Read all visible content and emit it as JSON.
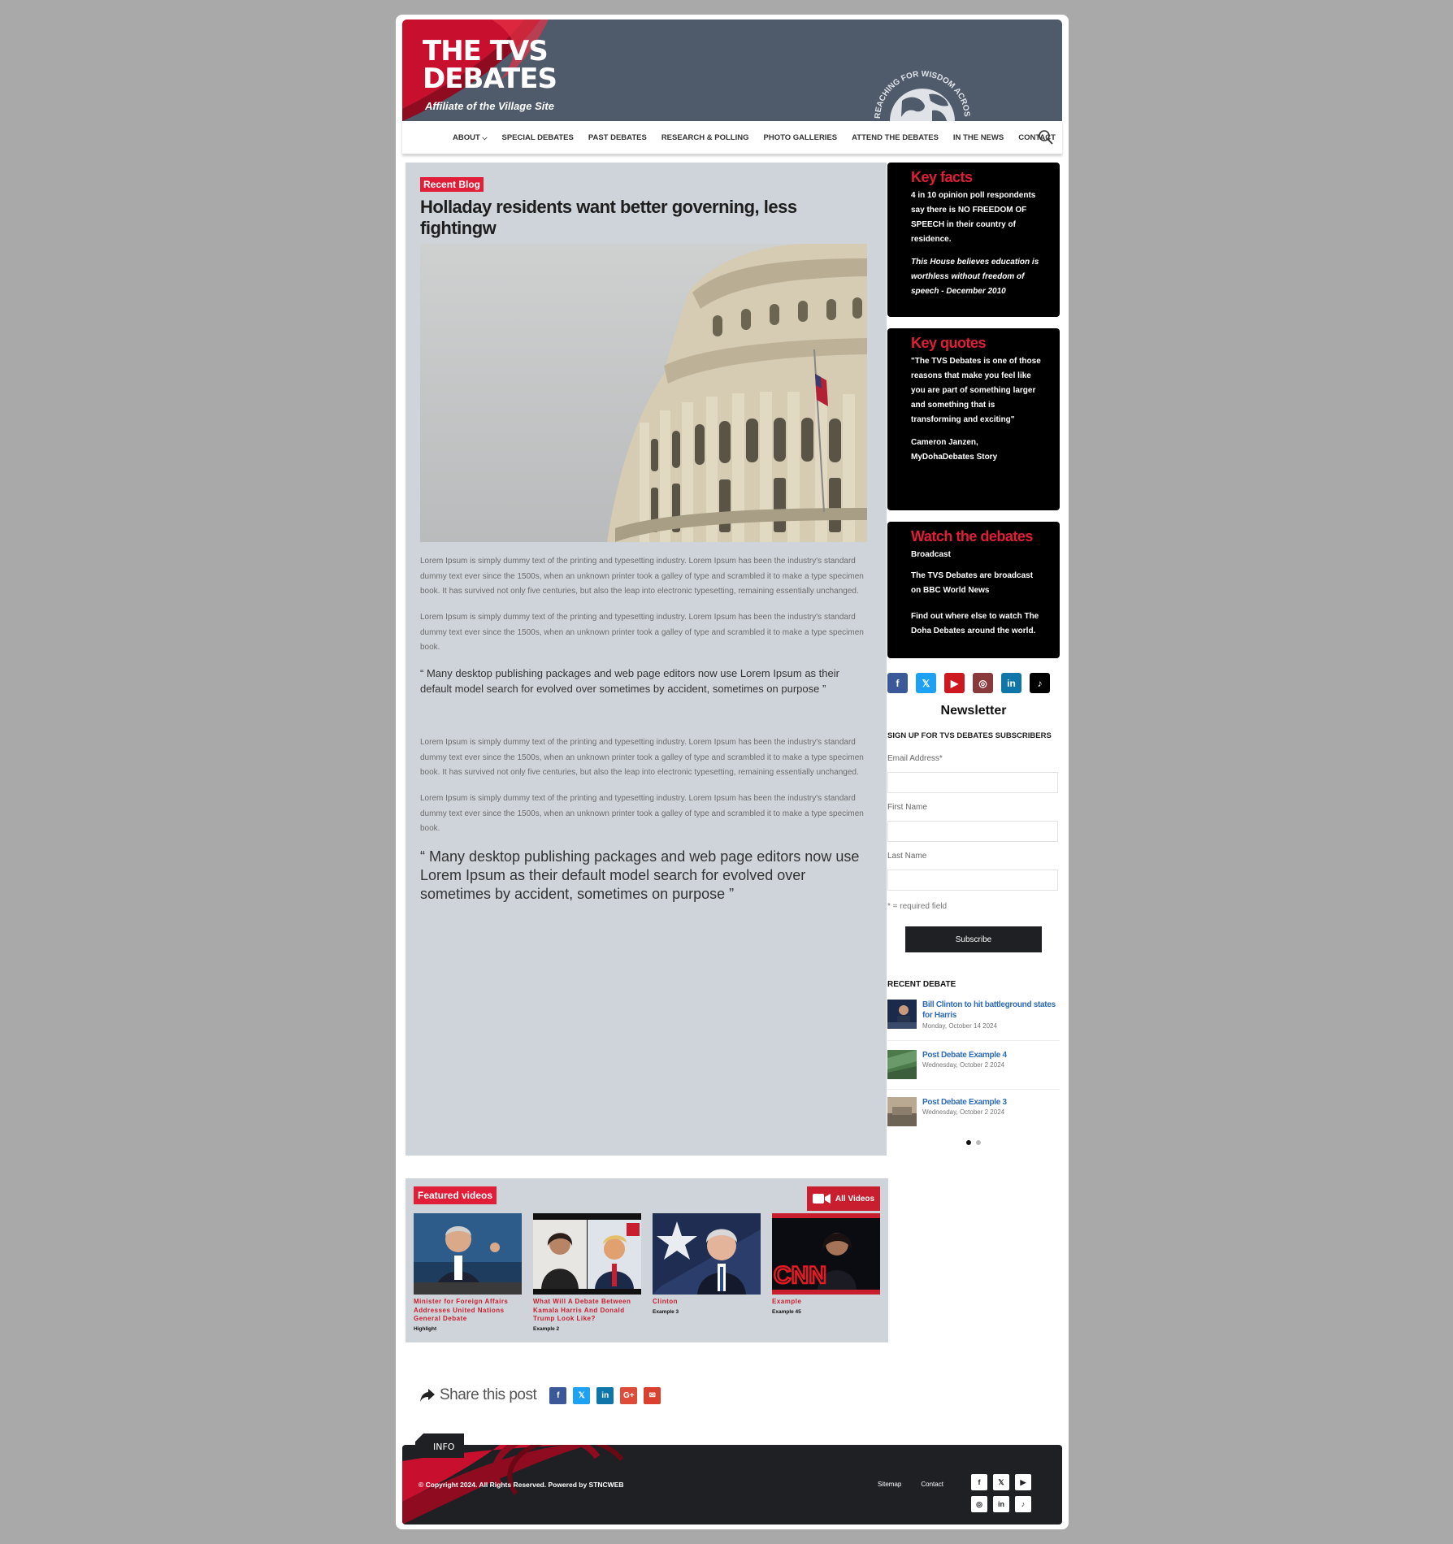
{
  "header": {
    "title_line1": "THE TVS",
    "title_line2": "DEBATES",
    "subtitle": "Affiliate of the Village Site",
    "globe_text": "REACHING FOR WISDOM ACROSS BOUNDARIES"
  },
  "nav": {
    "items": [
      "ABOUT",
      "SPECIAL DEBATES",
      "PAST DEBATES",
      "RESEARCH & POLLING",
      "PHOTO GALLERIES",
      "ATTEND THE DEBATES",
      "IN THE NEWS",
      "CONTACT"
    ],
    "about_chevron": "⌵"
  },
  "post": {
    "badge": "Recent Blog",
    "title": "Holladay residents want better governing, less fightingw",
    "paragraphs": [
      "Lorem Ipsum is simply dummy text of the printing and typesetting industry. Lorem Ipsum has been the industry's standard dummy text ever since the 1500s, when an unknown printer took a galley of type and scrambled it to make a type specimen book. It has survived not only five centuries, but also the leap into electronic typesetting, remaining essentially unchanged.",
      "Lorem Ipsum is simply dummy text of the printing and typesetting industry. Lorem Ipsum has been the industry's standard dummy text ever since the 1500s, when an unknown printer took a galley of type and scrambled it to make a type specimen book.",
      "“ Many desktop publishing packages and web page editors now use Lorem Ipsum as their default model search for evolved over sometimes by accident, sometimes on purpose ”",
      "Lorem Ipsum is simply dummy text of the printing and typesetting industry. Lorem Ipsum has been the industry's standard dummy text ever since the 1500s, when an unknown printer took a galley of type and scrambled it to make a type specimen book. It has survived not only five centuries, but also the leap into electronic typesetting, remaining essentially unchanged.",
      "Lorem Ipsum is simply dummy text of the printing and typesetting industry. Lorem Ipsum has been the industry's standard dummy text ever since the 1500s, when an unknown printer took a galley of type and scrambled it to make a type specimen book.",
      "“ Many desktop publishing packages and web page editors now use Lorem Ipsum as their default model search for evolved over sometimes by accident, sometimes on purpose ”"
    ]
  },
  "key_facts": {
    "title": "Key facts",
    "text1": "4 in 10 opinion poll respondents say there is NO FREEDOM OF SPEECH in their country of residence.",
    "text2": "This House believes education is worthless without freedom of speech - December 2010"
  },
  "key_quotes": {
    "title": "Key quotes",
    "quote": "\"The TVS Debates is one of those reasons that make you feel like you are part of something larger and something that is transforming and exciting\"",
    "author": "Cameron Janzen, MyDohaDebates Story"
  },
  "watch": {
    "title": "Watch the debates",
    "subtitle": "Broadcast",
    "text1": "The TVS Debates are broadcast on BBC World News",
    "text2": "Find out where else to watch The Doha Debates around the world."
  },
  "social": [
    "f",
    "𝕏",
    "▶",
    "◎",
    "in",
    "♪"
  ],
  "newsletter": {
    "title": "Newsletter",
    "subtitle": "SIGN UP FOR TVS DEBATES SUBSCRIBERS",
    "email_label": "Email Address*",
    "first_label": "First Name",
    "last_label": "Last Name",
    "required": "* = required field",
    "button": "Subscribe"
  },
  "recent_debate": {
    "title": "RECENT DEBATE",
    "items": [
      {
        "title": "Bill Clinton to hit battleground states for Harris",
        "date": "Monday, October 14 2024"
      },
      {
        "title": "Post Debate Example 4",
        "date": "Wednesday, October 2 2024"
      },
      {
        "title": "Post Debate Example 3",
        "date": "Wednesday, October 2 2024"
      }
    ]
  },
  "videos": {
    "badge": "Featured videos",
    "all_button": "All Videos",
    "items": [
      {
        "title": "Minister for Foreign Affairs Addresses United Nations General Debate",
        "tag": "Highlight"
      },
      {
        "title": "What Will A Debate Between Kamala Harris And Donald Trump Look Like?",
        "tag": "Example 2"
      },
      {
        "title": "Clinton",
        "tag": "Example 3"
      },
      {
        "title": "Example",
        "tag": "Example 45"
      }
    ]
  },
  "share": {
    "label": "Share this post",
    "buttons": [
      "f",
      "𝕏",
      "in",
      "G+",
      "✉"
    ]
  },
  "footer": {
    "tag": "INFO",
    "copyright": "© Copyright 2024. All Rights Reserved. Powered by STNCWEB",
    "links": [
      "Sitemap",
      "Contact"
    ],
    "social": [
      "f",
      "𝕏",
      "▶",
      "◎",
      "in",
      "♪"
    ]
  },
  "colors": {
    "accent_red": "#e01e37",
    "header_slate": "#4f5a6b",
    "link_blue": "#2d6bb5",
    "dark": "#1e2024"
  }
}
